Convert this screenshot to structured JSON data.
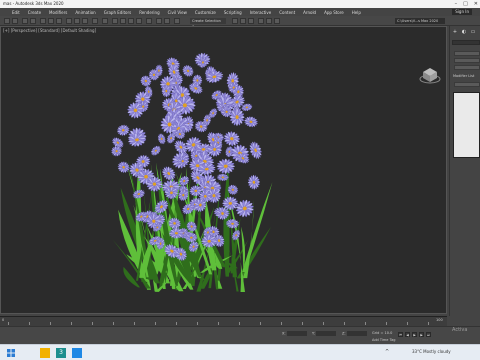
{
  "titlebar": {
    "title": "mas - Autodesk 3ds Max 2020"
  },
  "menu": {
    "items": [
      "Edit",
      "Create",
      "Modifiers",
      "Animation",
      "Graph Editors",
      "Rendering",
      "Civil View",
      "Customize",
      "Scripting",
      "Interactive",
      "Content",
      "Arnold",
      "App Store",
      "Help"
    ],
    "signin": "Sign In"
  },
  "toolbar": {
    "selection_set": "Create Selection Se",
    "workspace": "C:\\Users\\V...s Max 2020"
  },
  "viewport": {
    "label": "[+] [Perspective] [Standard] [Default Shading]"
  },
  "cmdpanel": {
    "modifier_list": "Modifier List"
  },
  "timeline": {
    "start": "0",
    "end": "100"
  },
  "status": {
    "x_label": "X:",
    "y_label": "Y:",
    "z_label": "Z:",
    "grid": "Grid = 10.0",
    "add_time_tag": "Add Time Tag",
    "activate": "Activa"
  },
  "taskbar": {
    "weather": "33°C  Mostly cloudy",
    "tray": "^"
  },
  "colors": {
    "petal": "#8f86d8",
    "petal_light": "#b9b4ee",
    "center": "#e0a020",
    "leaf": "#5fbf3a",
    "leaf_dark": "#2f6e1c"
  }
}
